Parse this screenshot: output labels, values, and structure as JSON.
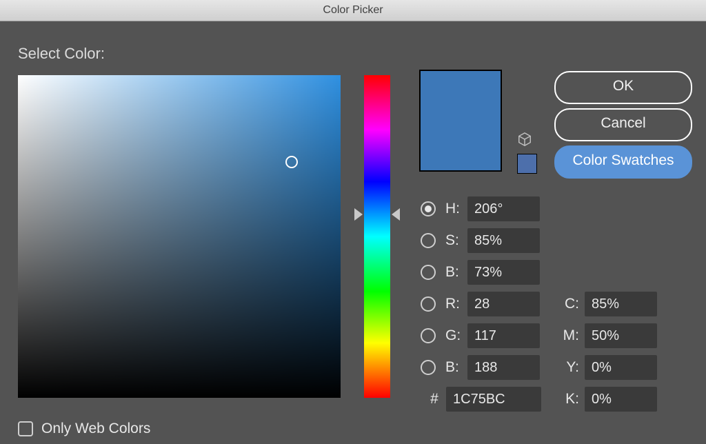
{
  "window": {
    "title": "Color Picker"
  },
  "heading": "Select Color:",
  "buttons": {
    "ok": "OK",
    "cancel": "Cancel",
    "swatches": "Color Swatches"
  },
  "preview": {
    "new_color": "#3d78b8",
    "small_color": "#4d6fab"
  },
  "hsb": {
    "h": {
      "label": "H:",
      "value": "206°",
      "selected": true
    },
    "s": {
      "label": "S:",
      "value": "85%",
      "selected": false
    },
    "b": {
      "label": "B:",
      "value": "73%",
      "selected": false
    }
  },
  "rgb": {
    "r": {
      "label": "R:",
      "value": "28"
    },
    "g": {
      "label": "G:",
      "value": "117"
    },
    "b": {
      "label": "B:",
      "value": "188"
    }
  },
  "hex": {
    "hash": "#",
    "value": "1C75BC"
  },
  "cmyk": {
    "c": {
      "label": "C:",
      "value": "85%"
    },
    "m": {
      "label": "M:",
      "value": "50%"
    },
    "y": {
      "label": "Y:",
      "value": "0%"
    },
    "k": {
      "label": "K:",
      "value": "0%"
    }
  },
  "only_web_colors": {
    "label": "Only Web Colors",
    "checked": false
  }
}
